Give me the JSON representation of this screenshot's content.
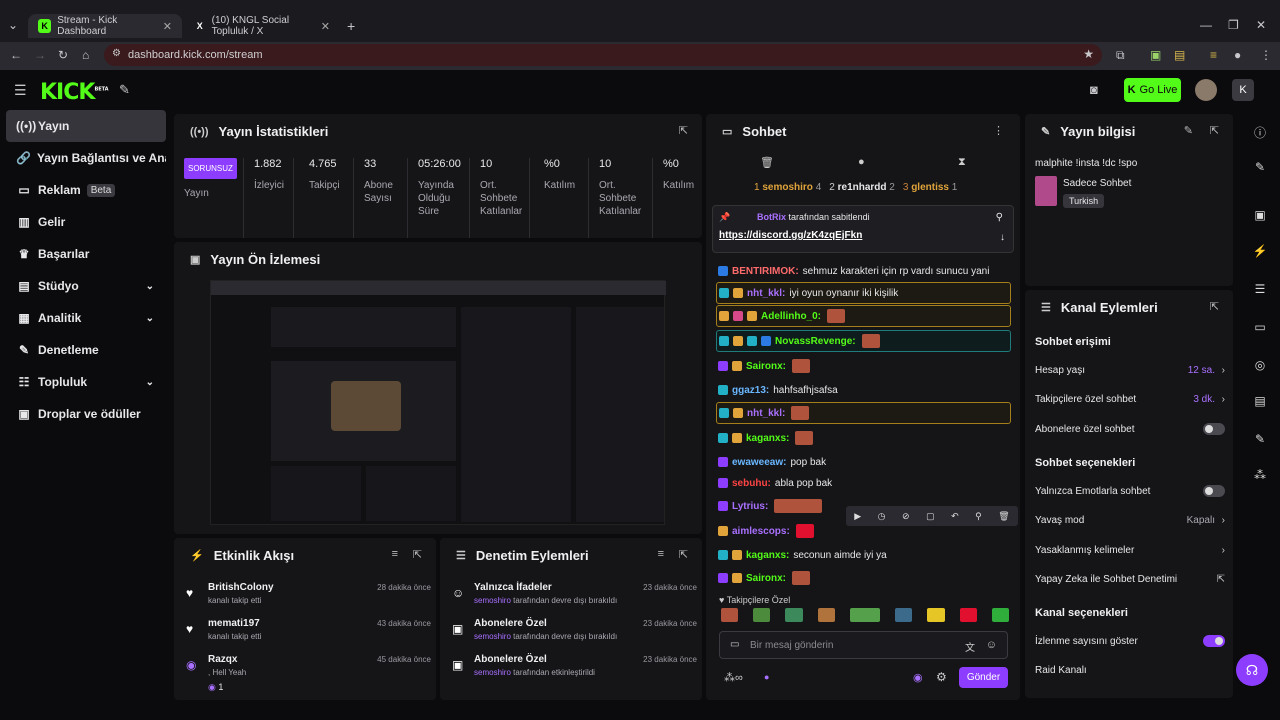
{
  "browser": {
    "tabs": [
      {
        "title": "Stream - Kick Dashboard",
        "icon": "kick-favicon"
      },
      {
        "title": "(10) KNGL Social Topluluk / X",
        "icon": "x-favicon"
      }
    ],
    "url": "dashboard.kick.com/stream"
  },
  "header": {
    "logo": "KICK",
    "logo_sup": "BETA",
    "go_live": "Go Live"
  },
  "sidebar": {
    "items": [
      {
        "label": "Yayın",
        "icon": "stream-icon"
      },
      {
        "label": "Yayın Bağlantısı ve Anahtarı",
        "icon": "link-icon"
      },
      {
        "label": "Reklam",
        "icon": "ad-icon",
        "badge": "Beta"
      },
      {
        "label": "Gelir",
        "icon": "revenue-icon"
      },
      {
        "label": "Başarılar",
        "icon": "trophy-icon"
      },
      {
        "label": "Stüdyo",
        "icon": "studio-icon"
      },
      {
        "label": "Analitik",
        "icon": "analytics-icon"
      },
      {
        "label": "Denetleme",
        "icon": "wrench-icon"
      },
      {
        "label": "Topluluk",
        "icon": "community-icon"
      },
      {
        "label": "Droplar ve ödüller",
        "icon": "gift-icon"
      }
    ]
  },
  "stats": {
    "title": "Yayın İstatistikleri",
    "status_badge": "SORUNSUZ",
    "status_label": "Yayın",
    "items": [
      {
        "value": "1.882",
        "label": "İzleyici"
      },
      {
        "value": "4.765",
        "label": "Takipçi"
      },
      {
        "value": "33",
        "label": "Abone Sayısı"
      },
      {
        "value": "05:26:00",
        "label": "Yayında Olduğu Süre"
      },
      {
        "value": "10",
        "label": "Ort. Sohbete Katılanlar"
      },
      {
        "value": "%0",
        "label": "Katılım"
      },
      {
        "value": "10",
        "label": "Ort. Sohbete Katılanlar"
      },
      {
        "value": "%0",
        "label": "Katılım"
      }
    ]
  },
  "preview": {
    "title": "Yayın Ön İzlemesi"
  },
  "activity": {
    "title": "Etkinlik Akışı",
    "items": [
      {
        "name": "BritishColony",
        "sub": "kanalı takip etti",
        "time": "28 dakika önce"
      },
      {
        "name": "memati197",
        "sub": "kanalı takip etti",
        "time": "43 dakika önce"
      },
      {
        "name": "Razqx",
        "sub": ", Hell Yeah",
        "time": "45 dakika önce",
        "extra": "1"
      }
    ]
  },
  "moderation": {
    "title": "Denetim Eylemleri",
    "items": [
      {
        "name": "Yalnızca İfadeler",
        "user": "semoshiro",
        "sub": "tarafından devre dışı bırakıldı",
        "time": "23 dakika önce"
      },
      {
        "name": "Abonelere Özel",
        "user": "semoshiro",
        "sub": "tarafından devre dışı bırakıldı",
        "time": "23 dakika önce"
      },
      {
        "name": "Abonelere Özel",
        "user": "semoshiro",
        "sub": "tarafından etkinleştirildi",
        "time": "23 dakika önce"
      }
    ]
  },
  "chat": {
    "title": "Sohbet",
    "top_gifters": [
      {
        "rank": "1",
        "name": "semoshiro",
        "count": "4"
      },
      {
        "rank": "2",
        "name": "re1nhardd",
        "count": "2"
      },
      {
        "rank": "3",
        "name": "glentiss",
        "count": "1"
      }
    ],
    "pinned_by": "BotRix",
    "pinned_label": "tarafından sabitlendi",
    "pinned_link": "https://discord.gg/zK4zqEjFkn",
    "messages": [
      {
        "user": "BENTIRIMOK:",
        "text": "sehmuz karakteri için rp vardı sunucu yani",
        "color": "#ff6b6b"
      },
      {
        "user": "nht_kkl:",
        "text": "iyi oyun oynanır iki kişilik",
        "color": "#a970ff"
      },
      {
        "user": "Adellinho_0:",
        "text": "",
        "color": "#53fc18"
      },
      {
        "user": "NovassRevenge:",
        "text": "",
        "color": "#53fc18"
      },
      {
        "user": "Saironx:",
        "text": "",
        "color": "#53fc18"
      },
      {
        "user": "ggaz13:",
        "text": "hahfsafhjsafsa",
        "color": "#6ab7ff"
      },
      {
        "user": "nht_kkl:",
        "text": "",
        "color": "#a970ff"
      },
      {
        "user": "kaganxs:",
        "text": "",
        "color": "#53fc18"
      },
      {
        "user": "ewaweeaw:",
        "text": "pop bak",
        "color": "#6ab7ff"
      },
      {
        "user": "sebuhu:",
        "text": "abla pop bak",
        "color": "#ff4444"
      },
      {
        "user": "Lytrius:",
        "text": "",
        "color": "#a970ff"
      },
      {
        "user": "aimlescops:",
        "text": "",
        "color": "#a970ff"
      },
      {
        "user": "kaganxs:",
        "text": "seconun aimde iyi ya",
        "color": "#53fc18"
      },
      {
        "user": "Saironx:",
        "text": "",
        "color": "#53fc18"
      }
    ],
    "followers_only": "Takipçilere Özel",
    "input_placeholder": "Bir mesaj gönderin",
    "send": "Gönder"
  },
  "stream_info": {
    "title": "Yayın bilgisi",
    "stream_title": "malphite !insta !dc !spo",
    "category": "Sadece Sohbet",
    "language": "Turkish"
  },
  "channel_actions": {
    "title": "Kanal Eylemleri",
    "chat_access": "Sohbet erişimi",
    "account_age": {
      "label": "Hesap yaşı",
      "value": "12 sa."
    },
    "followers_chat": {
      "label": "Takipçilere özel sohbet",
      "value": "3 dk."
    },
    "subs_chat": {
      "label": "Abonelere özel sohbet"
    },
    "chat_options": "Sohbet seçenekleri",
    "emotes_only": {
      "label": "Yalnızca Emotlarla sohbet"
    },
    "slow_mode": {
      "label": "Yavaş mod",
      "value": "Kapalı"
    },
    "banned_words": {
      "label": "Yasaklanmış kelimeler"
    },
    "ai_mod": {
      "label": "Yapay Zeka ile Sohbet Denetimi"
    },
    "channel_options": "Kanal seçenekleri",
    "show_viewers": {
      "label": "İzlenme sayısını göster"
    },
    "raid": {
      "label": "Raid Kanalı"
    }
  }
}
